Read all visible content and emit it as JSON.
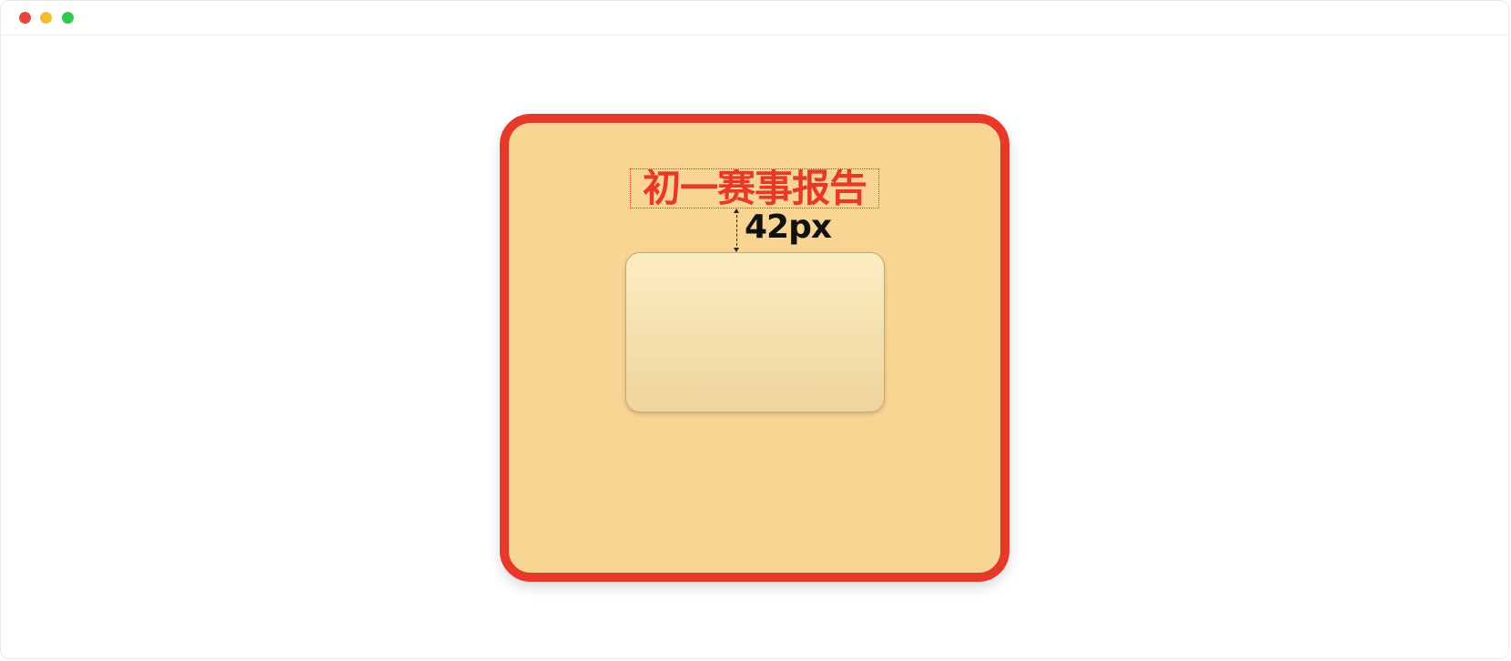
{
  "window": {
    "controls": [
      {
        "name": "close",
        "color": "#e5483a"
      },
      {
        "name": "minimize",
        "color": "#f4bd2c"
      },
      {
        "name": "maximize",
        "color": "#2ec94e"
      }
    ]
  },
  "card": {
    "background": "#f9d594",
    "border_color": "#e6392a",
    "title": "初一赛事报告",
    "title_color": "#e6392a",
    "spacing_label": "42px",
    "inner_gradient_top": "#fbedc1",
    "inner_gradient_bottom": "#efd49c"
  }
}
